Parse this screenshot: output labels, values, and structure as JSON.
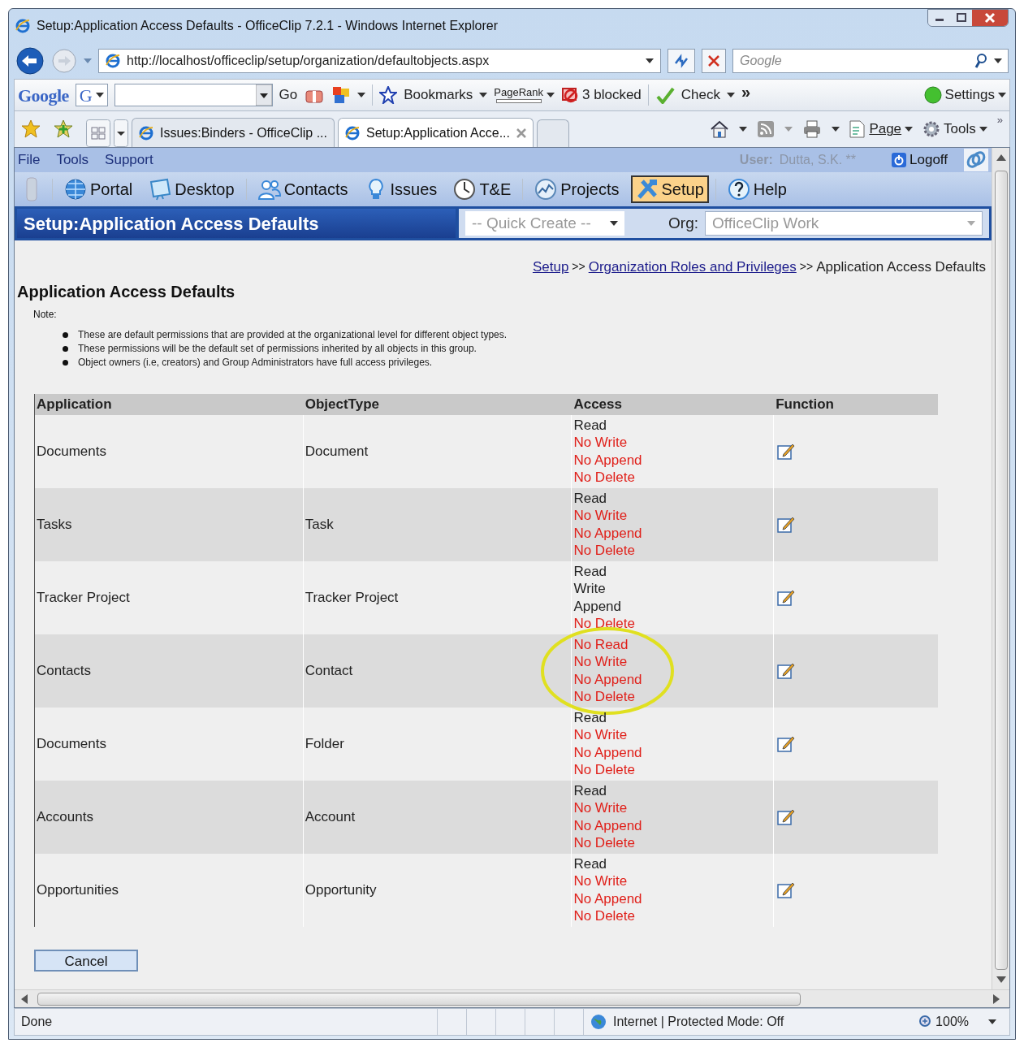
{
  "window": {
    "title": "Setup:Application Access Defaults - OfficeClip 7.2.1 - Windows Internet Explorer"
  },
  "address_bar": {
    "url": "http://localhost/officeclip/setup/organization/defaultobjects.aspx"
  },
  "search": {
    "placeholder": "Google"
  },
  "google_toolbar": {
    "logo": "Google",
    "g_button": "G",
    "go": "Go",
    "bookmarks": "Bookmarks",
    "pagerank": "PageRank",
    "blocked": "3 blocked",
    "check": "Check",
    "more": "»",
    "settings": "Settings"
  },
  "tabs": [
    {
      "label": "Issues:Binders - OfficeClip ...",
      "selected": false
    },
    {
      "label": "Setup:Application Acce...",
      "selected": true
    }
  ],
  "command_bar": {
    "page": "Page",
    "tools": "Tools",
    "more": "»"
  },
  "app_menu": [
    "File",
    "Tools",
    "Support"
  ],
  "user": {
    "label": "User:",
    "name": "Dutta, S.K. **"
  },
  "logoff": "Logoff",
  "nav": [
    {
      "label": "Portal",
      "selected": false
    },
    {
      "label": "Desktop",
      "selected": false
    },
    {
      "label": "Contacts",
      "selected": false
    },
    {
      "label": "Issues",
      "selected": false
    },
    {
      "label": "T&E",
      "selected": false
    },
    {
      "label": "Projects",
      "selected": false
    },
    {
      "label": "Setup",
      "selected": true
    },
    {
      "label": "Help",
      "selected": false
    }
  ],
  "page_header": {
    "title": "Setup:Application Access Defaults",
    "quick_create": "-- Quick Create --",
    "org_label": "Org:",
    "org": "OfficeClip Work"
  },
  "breadcrumb": [
    {
      "label": "Setup",
      "kind": "link"
    },
    {
      "label": ">>",
      "kind": "separator"
    },
    {
      "label": "Organization Roles and Privileges",
      "kind": "link"
    },
    {
      "label": ">>",
      "kind": "separator"
    },
    {
      "label": "Application Access Defaults",
      "kind": "current"
    }
  ],
  "heading": "Application Access Defaults",
  "note": {
    "label": "Note:",
    "items": [
      "These are default permissions that are provided at the organizational level for different object types.",
      "These permissions will be the default set of permissions inherited by all objects in this group.",
      "Object owners (i.e, creators) and Group Administrators have full access privileges."
    ]
  },
  "table": {
    "columns": [
      "Application",
      "ObjectType",
      "Access",
      "Function"
    ],
    "rows": [
      {
        "application": "Documents",
        "object_type": "Document",
        "highlighted": false,
        "access": [
          {
            "label": "Read",
            "granted": true
          },
          {
            "label": "No Write",
            "granted": false
          },
          {
            "label": "No Append",
            "granted": false
          },
          {
            "label": "No Delete",
            "granted": false
          }
        ]
      },
      {
        "application": "Tasks",
        "object_type": "Task",
        "highlighted": false,
        "access": [
          {
            "label": "Read",
            "granted": true
          },
          {
            "label": "No Write",
            "granted": false
          },
          {
            "label": "No Append",
            "granted": false
          },
          {
            "label": "No Delete",
            "granted": false
          }
        ]
      },
      {
        "application": "Tracker Project",
        "object_type": "Tracker Project",
        "highlighted": false,
        "access": [
          {
            "label": "Read",
            "granted": true
          },
          {
            "label": "Write",
            "granted": true
          },
          {
            "label": "Append",
            "granted": true
          },
          {
            "label": "No Delete",
            "granted": false
          }
        ]
      },
      {
        "application": "Contacts",
        "object_type": "Contact",
        "highlighted": true,
        "access": [
          {
            "label": "No Read",
            "granted": false
          },
          {
            "label": "No Write",
            "granted": false
          },
          {
            "label": "No Append",
            "granted": false
          },
          {
            "label": "No Delete",
            "granted": false
          }
        ]
      },
      {
        "application": "Documents",
        "object_type": "Folder",
        "highlighted": false,
        "access": [
          {
            "label": "Read",
            "granted": true
          },
          {
            "label": "No Write",
            "granted": false
          },
          {
            "label": "No Append",
            "granted": false
          },
          {
            "label": "No Delete",
            "granted": false
          }
        ]
      },
      {
        "application": "Accounts",
        "object_type": "Account",
        "highlighted": false,
        "access": [
          {
            "label": "Read",
            "granted": true
          },
          {
            "label": "No Write",
            "granted": false
          },
          {
            "label": "No Append",
            "granted": false
          },
          {
            "label": "No Delete",
            "granted": false
          }
        ]
      },
      {
        "application": "Opportunities",
        "object_type": "Opportunity",
        "highlighted": false,
        "access": [
          {
            "label": "Read",
            "granted": true
          },
          {
            "label": "No Write",
            "granted": false
          },
          {
            "label": "No Append",
            "granted": false
          },
          {
            "label": "No Delete",
            "granted": false
          }
        ]
      }
    ]
  },
  "cancel": "Cancel",
  "status_bar": {
    "text": "Done",
    "zone": "Internet | Protected Mode: Off",
    "zoom": "100%"
  }
}
